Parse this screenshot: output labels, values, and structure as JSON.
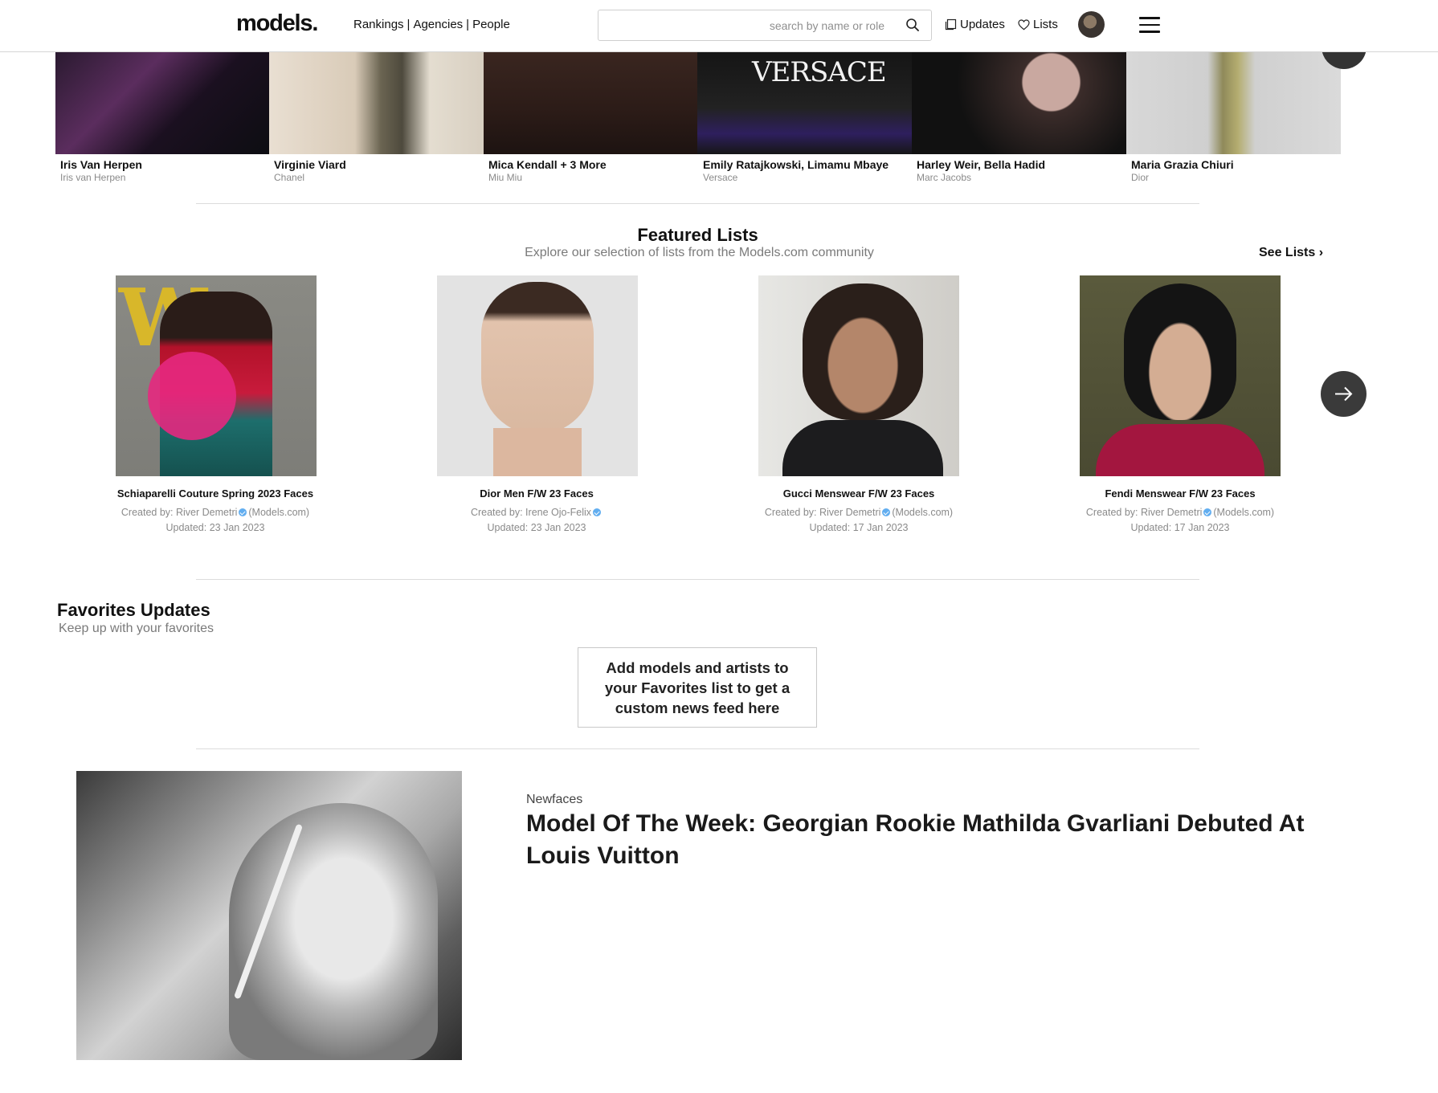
{
  "header": {
    "logo": "models.",
    "nav": [
      {
        "label": "Rankings"
      },
      {
        "label": "Agencies"
      },
      {
        "label": "People"
      }
    ],
    "nav_separator": "|",
    "search_placeholder": "search by name or role",
    "updates_label": "Updates",
    "lists_label": "Lists"
  },
  "strip": [
    {
      "name": "Iris Van Herpen",
      "sub": "Iris van Herpen"
    },
    {
      "name": "Virginie Viard",
      "sub": "Chanel"
    },
    {
      "name": "Mica Kendall + 3 More",
      "sub": "Miu Miu"
    },
    {
      "name": "Emily Ratajkowski, Limamu Mbaye",
      "sub": "Versace",
      "overlay_text": "VERSACE"
    },
    {
      "name": "Harley Weir, Bella Hadid",
      "sub": "Marc Jacobs"
    },
    {
      "name": "Maria Grazia Chiuri",
      "sub": "Dior"
    }
  ],
  "featured": {
    "title": "Featured Lists",
    "subtitle": "Explore our selection of lists from the Models.com community",
    "see_lists": "See Lists ›",
    "cards": [
      {
        "title": "Schiaparelli Couture Spring 2023 Faces",
        "created_prefix": "Created by: River Demetri",
        "created_suffix": "(Models.com)",
        "updated": "Updated: 23 Jan 2023",
        "cover_text": "W"
      },
      {
        "title": "Dior Men F/W 23 Faces",
        "created_prefix": "Created by: Irene Ojo-Felix",
        "created_suffix": "",
        "updated": "Updated: 23 Jan 2023"
      },
      {
        "title": "Gucci Menswear F/W 23 Faces",
        "created_prefix": "Created by: River Demetri",
        "created_suffix": "(Models.com)",
        "updated": "Updated: 17 Jan 2023"
      },
      {
        "title": "Fendi Menswear F/W 23 Faces",
        "created_prefix": "Created by: River Demetri",
        "created_suffix": "(Models.com)",
        "updated": "Updated: 17 Jan 2023"
      }
    ]
  },
  "favorites": {
    "title": "Favorites Updates",
    "subtitle": "Keep up with your favorites",
    "empty_message": "Add models and artists to your Favorites list to get a custom news feed here"
  },
  "article": {
    "category": "Newfaces",
    "title": "Model Of The Week: Georgian Rookie Mathilda Gvarliani Debuted At Louis Vuitton"
  },
  "icons": {
    "search": "search-icon",
    "updates": "copy-icon",
    "lists": "heart-icon",
    "menu": "hamburger-menu-icon",
    "next": "arrow-right-icon",
    "verified": "verified-badge-icon"
  },
  "colors": {
    "text": "#111111",
    "muted": "#8a8a8a",
    "divider": "#dcdcdc",
    "arrow_bg": "#3a3a3a",
    "verified": "#62aef0"
  }
}
